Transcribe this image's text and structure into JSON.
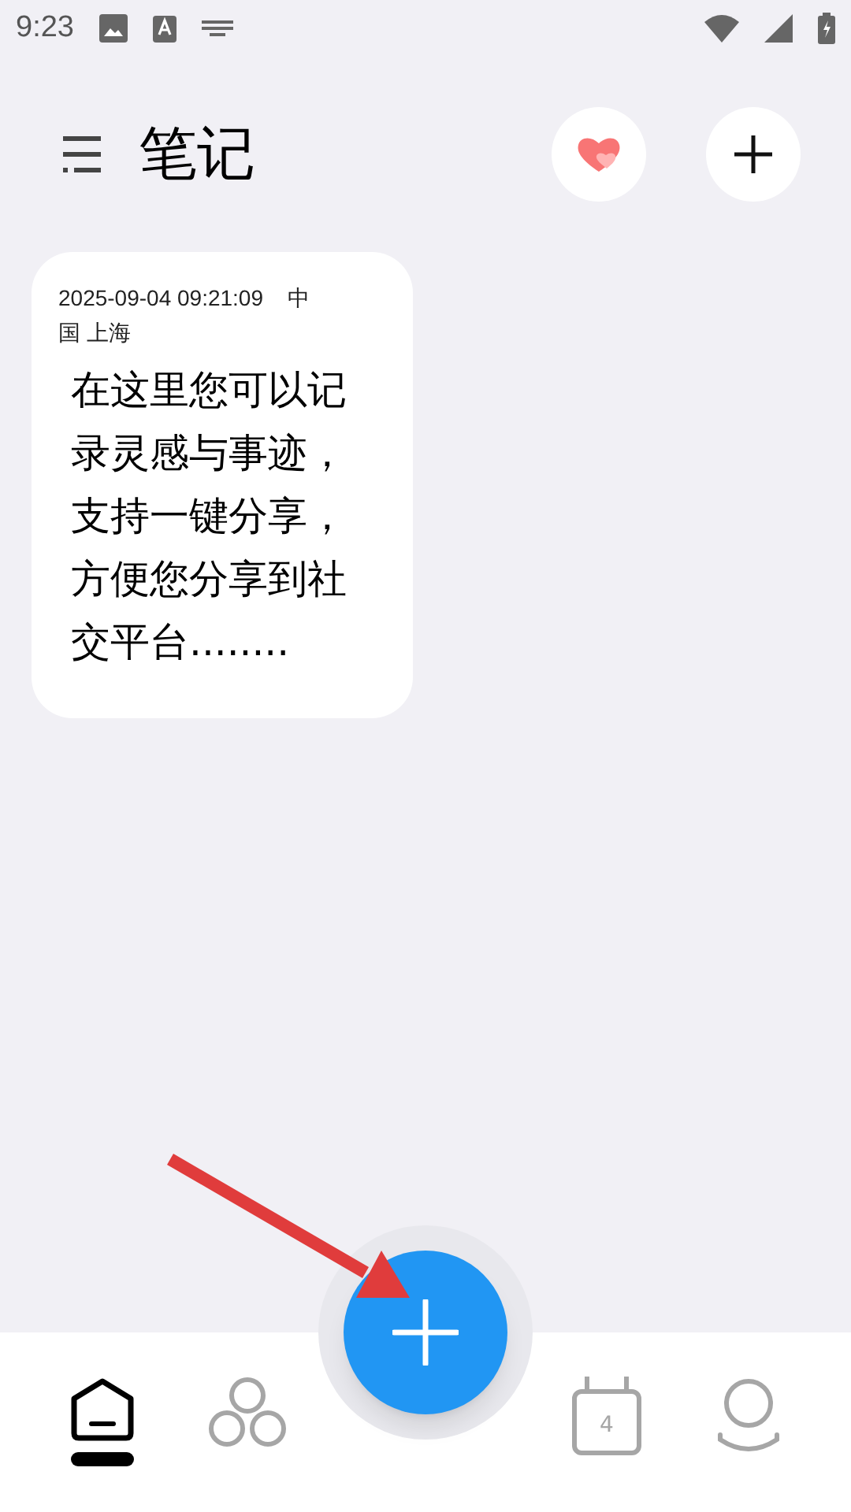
{
  "status_bar": {
    "time": "9:23"
  },
  "header": {
    "title": "笔记"
  },
  "notes": [
    {
      "meta": "2025-09-04 09:21:09    中国 上海",
      "body": "在这里您可以记录灵感与事迹，支持一键分享，方便您分享到社交平台........"
    }
  ],
  "bottom_nav": [
    {
      "kind": "home",
      "selected": true
    },
    {
      "kind": "community",
      "selected": false
    },
    {
      "kind": "calendar",
      "selected": false,
      "day": "4"
    },
    {
      "kind": "profile",
      "selected": false
    }
  ]
}
